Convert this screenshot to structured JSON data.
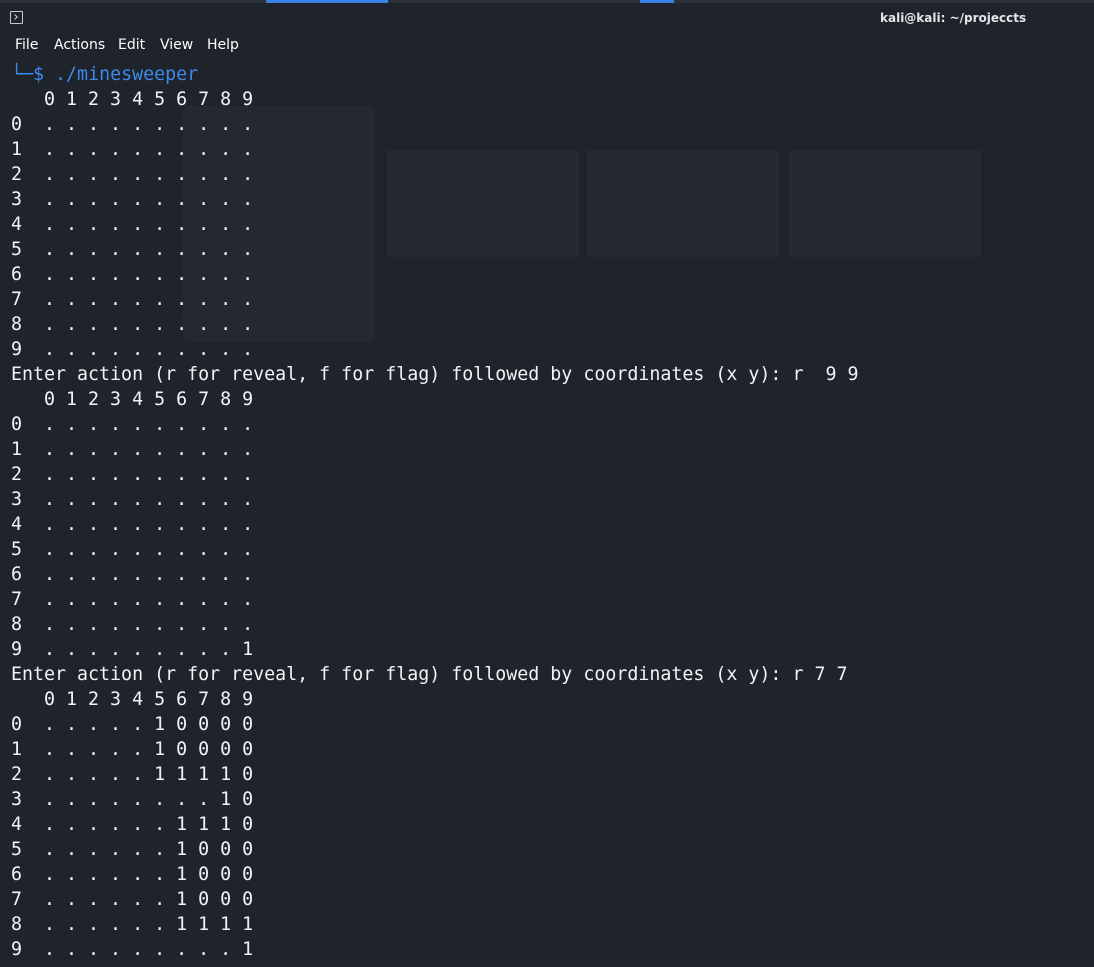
{
  "window": {
    "title": "kali@kali: ~/projeccts"
  },
  "menu": {
    "file": "File",
    "actions": "Actions",
    "edit": "Edit",
    "view": "View",
    "help": "Help"
  },
  "prompt": {
    "corner": "└─",
    "symbol": "$",
    "command": "./minesweeper"
  },
  "boards": [
    {
      "header": "   0 1 2 3 4 5 6 7 8 9",
      "rows": [
        "0  . . . . . . . . . .",
        "1  . . . . . . . . . .",
        "2  . . . . . . . . . .",
        "3  . . . . . . . . . .",
        "4  . . . . . . . . . .",
        "5  . . . . . . . . . .",
        "6  . . . . . . . . . .",
        "7  . . . . . . . . . .",
        "8  . . . . . . . . . .",
        "9  . . . . . . . . . ."
      ],
      "input_prompt": "Enter action (r for reveal, f for flag) followed by coordinates (x y): r  9 9"
    },
    {
      "header": "   0 1 2 3 4 5 6 7 8 9",
      "rows": [
        "0  . . . . . . . . . .",
        "1  . . . . . . . . . .",
        "2  . . . . . . . . . .",
        "3  . . . . . . . . . .",
        "4  . . . . . . . . . .",
        "5  . . . . . . . . . .",
        "6  . . . . . . . . . .",
        "7  . . . . . . . . . .",
        "8  . . . . . . . . . .",
        "9  . . . . . . . . . 1"
      ],
      "input_prompt": "Enter action (r for reveal, f for flag) followed by coordinates (x y): r 7 7"
    },
    {
      "header": "   0 1 2 3 4 5 6 7 8 9",
      "rows": [
        "0  . . . . . 1 0 0 0 0",
        "1  . . . . . 1 0 0 0 0",
        "2  . . . . . 1 1 1 1 0",
        "3  . . . . . . . . 1 0",
        "4  . . . . . . 1 1 1 0",
        "5  . . . . . . 1 0 0 0",
        "6  . . . . . . 1 0 0 0",
        "7  . . . . . . 1 0 0 0",
        "8  . . . . . . 1 1 1 1",
        "9  . . . . . . . . . 1"
      ]
    }
  ]
}
